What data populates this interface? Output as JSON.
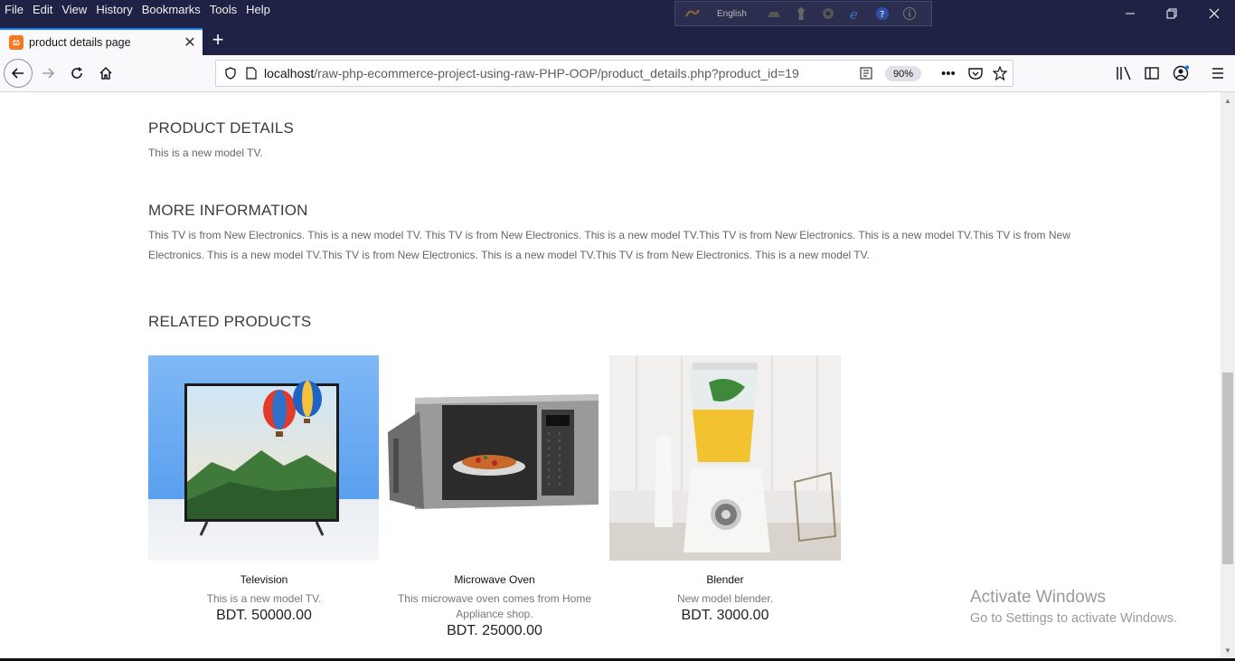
{
  "menu": [
    "File",
    "Edit",
    "View",
    "History",
    "Bookmarks",
    "Tools",
    "Help"
  ],
  "xampp": {
    "language": "English"
  },
  "tab": {
    "title": "product details page"
  },
  "url": {
    "host": "localhost",
    "path": "/raw-php-ecommerce-project-using-raw-PHP-OOP/product_details.php?product_id=19",
    "zoom": "90%"
  },
  "page": {
    "details_title": "PRODUCT DETAILS",
    "details_text": "This is a new model TV.",
    "more_title": "MORE INFORMATION",
    "more_text": "This TV is from New Electronics. This is a new model TV. This TV is from New Electronics. This is a new model TV.This TV is from New Electronics. This is a new model TV.This TV is from New Electronics. This is a new model TV.This TV is from New Electronics. This is a new model TV.This TV is from New Electronics. This is a new model TV.",
    "related_title": "RELATED PRODUCTS"
  },
  "products": [
    {
      "name": "Television",
      "desc": "This is a new model TV.",
      "price": "BDT. 50000.00"
    },
    {
      "name": "Microwave Oven",
      "desc": "This microwave oven comes from Home Appliance shop.",
      "price": "BDT. 25000.00"
    },
    {
      "name": "Blender",
      "desc": "New model blender.",
      "price": "BDT. 3000.00"
    }
  ],
  "watermark": {
    "line1": "Activate Windows",
    "line2": "Go to Settings to activate Windows."
  },
  "colors": {
    "titlebar": "#1f2244",
    "tab_accent": "#0a84ff",
    "xampp_orange": "#f57920"
  }
}
